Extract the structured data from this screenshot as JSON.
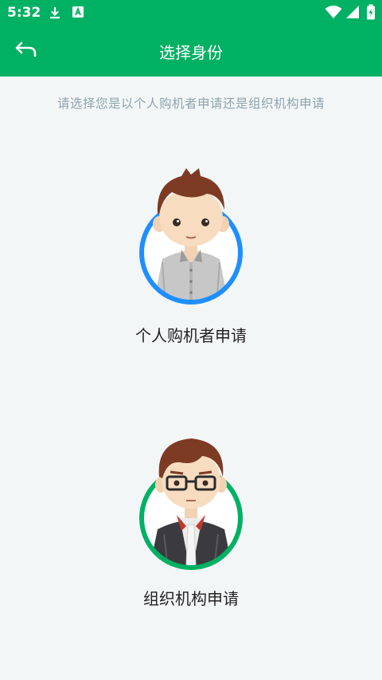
{
  "status": {
    "time": "5:32",
    "icons": [
      "download-icon",
      "font-a-icon",
      "wifi-icon",
      "signal-icon",
      "battery-icon"
    ]
  },
  "appbar": {
    "title": "选择身份",
    "back_icon": "back-arrow-icon"
  },
  "subtitle": "请选择您是以个人购机者申请还是组织机构申请",
  "options": [
    {
      "label": "个人购机者申请",
      "ring_color": "#1f8fff"
    },
    {
      "label": "组织机构申请",
      "ring_color": "#00b163"
    }
  ],
  "colors": {
    "header": "#00b163",
    "background": "#f3f6f7",
    "subtitle": "#8ea4ae"
  }
}
